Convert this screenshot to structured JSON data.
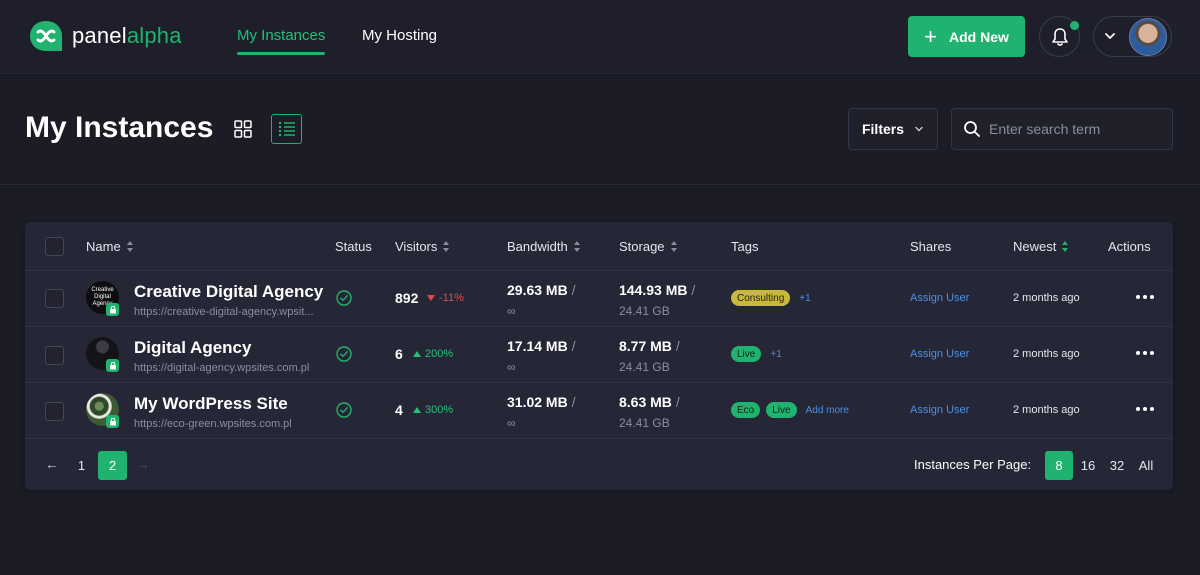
{
  "brand": {
    "name_part1": "panel",
    "name_part2": "alpha",
    "accent": "#1fb36f"
  },
  "nav": {
    "tabs": [
      {
        "label": "My Instances",
        "active": true
      },
      {
        "label": "My Hosting",
        "active": false
      }
    ]
  },
  "header": {
    "add_new_label": "Add New",
    "notifications_unread": true
  },
  "page": {
    "title": "My Instances",
    "view_mode": "list",
    "filters_label": "Filters",
    "search_placeholder": "Enter search term"
  },
  "table": {
    "columns": {
      "name": "Name",
      "status": "Status",
      "visitors": "Visitors",
      "bandwidth": "Bandwidth",
      "storage": "Storage",
      "tags": "Tags",
      "shares": "Shares",
      "newest": "Newest",
      "actions": "Actions"
    },
    "rows": [
      {
        "name": "Creative Digital Agency",
        "url": "https://creative-digital-agency.wpsit...",
        "thumb_text": "Creative Digital Agency",
        "visitors": "892",
        "trend": "-11%",
        "trend_dir": "down",
        "bandwidth": "29.63 MB",
        "bandwidth_limit": "∞",
        "storage": "144.93 MB",
        "storage_limit": "24.41 GB",
        "tags": [
          {
            "label": "Consulting",
            "kind": "consulting"
          }
        ],
        "tags_more": "+1",
        "share_label": "Assign User",
        "newest": "2 months ago"
      },
      {
        "name": "Digital Agency",
        "url": "https://digital-agency.wpsites.com.pl",
        "thumb_text": "",
        "visitors": "6",
        "trend": "200%",
        "trend_dir": "up",
        "bandwidth": "17.14 MB",
        "bandwidth_limit": "∞",
        "storage": "8.77 MB",
        "storage_limit": "24.41 GB",
        "tags": [
          {
            "label": "Live",
            "kind": "live"
          }
        ],
        "tags_more": "+1",
        "share_label": "Assign User",
        "newest": "2 months ago"
      },
      {
        "name": "My WordPress Site",
        "url": "https://eco-green.wpsites.com.pl",
        "thumb_text": "",
        "visitors": "4",
        "trend": "300%",
        "trend_dir": "up",
        "bandwidth": "31.02 MB",
        "bandwidth_limit": "∞",
        "storage": "8.63 MB",
        "storage_limit": "24.41 GB",
        "tags": [
          {
            "label": "Eco",
            "kind": "eco"
          },
          {
            "label": "Live",
            "kind": "live"
          }
        ],
        "tags_more": "Add more",
        "share_label": "Assign User",
        "newest": "2 months ago"
      }
    ]
  },
  "pagination": {
    "prev": "←",
    "next": "→",
    "pages": [
      {
        "label": "1",
        "active": false
      },
      {
        "label": "2",
        "active": true
      }
    ],
    "per_page_label": "Instances Per Page:",
    "per_page_options": [
      {
        "label": "8",
        "active": true
      },
      {
        "label": "16",
        "active": false
      },
      {
        "label": "32",
        "active": false
      },
      {
        "label": "All",
        "active": false
      }
    ]
  }
}
